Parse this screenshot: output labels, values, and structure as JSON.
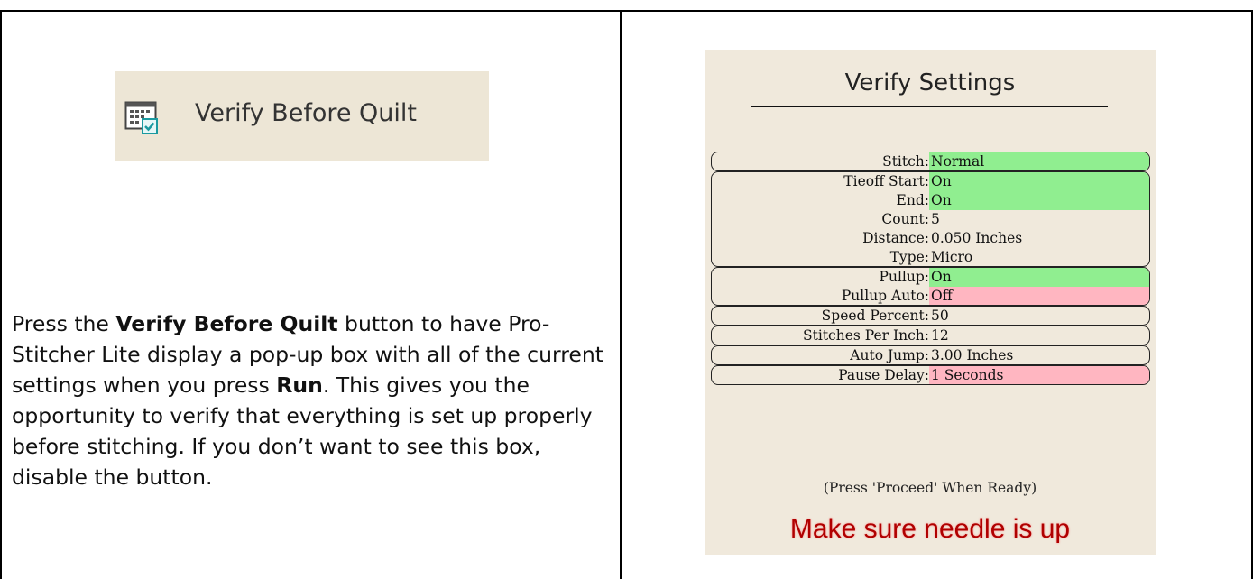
{
  "button": {
    "label": "Verify Before Quilt",
    "icon": "calendar-check-icon",
    "background": "#ede6d6"
  },
  "description": {
    "part1": "Press the ",
    "bold1": "Verify Before Quilt",
    "part2": " button to have Pro-Stitcher Lite display a pop-up box with all of the current settings when you press ",
    "bold2": "Run",
    "part3": ". This gives you the opportunity to verify that everything is set up properly before stitching. If you don’t want to see this box, disable the button."
  },
  "dialog": {
    "title": "Verify Settings",
    "background": "#f0e9dc",
    "highlight_green": "#90ee90",
    "highlight_pink": "#ffb6c1",
    "groups": [
      {
        "rows": [
          {
            "label": "Stitch:",
            "value": "Normal",
            "highlight": "green"
          }
        ]
      },
      {
        "rows": [
          {
            "label": "Tieoff Start:",
            "value": "On",
            "highlight": "green"
          },
          {
            "label": "End:",
            "value": "On",
            "highlight": "green"
          },
          {
            "label": "Count:",
            "value": "5",
            "highlight": "none"
          },
          {
            "label": "Distance:",
            "value": "0.050  Inches",
            "highlight": "none"
          },
          {
            "label": "Type:",
            "value": "Micro",
            "highlight": "none"
          }
        ]
      },
      {
        "rows": [
          {
            "label": "Pullup:",
            "value": "On",
            "highlight": "green"
          },
          {
            "label": "Pullup Auto:",
            "value": "Off",
            "highlight": "pink"
          }
        ]
      },
      {
        "rows": [
          {
            "label": "Speed Percent:",
            "value": "50",
            "highlight": "none"
          }
        ]
      },
      {
        "rows": [
          {
            "label": "Stitches Per Inch:",
            "value": "12",
            "highlight": "none"
          }
        ]
      },
      {
        "rows": [
          {
            "label": "Auto Jump:",
            "value": "3.00  Inches",
            "highlight": "none"
          }
        ]
      },
      {
        "rows": [
          {
            "label": "Pause Delay:",
            "value": "1 Seconds",
            "highlight": "pink"
          }
        ]
      }
    ],
    "hint": "(Press 'Proceed' When Ready)",
    "warning": "Make sure needle is up"
  }
}
